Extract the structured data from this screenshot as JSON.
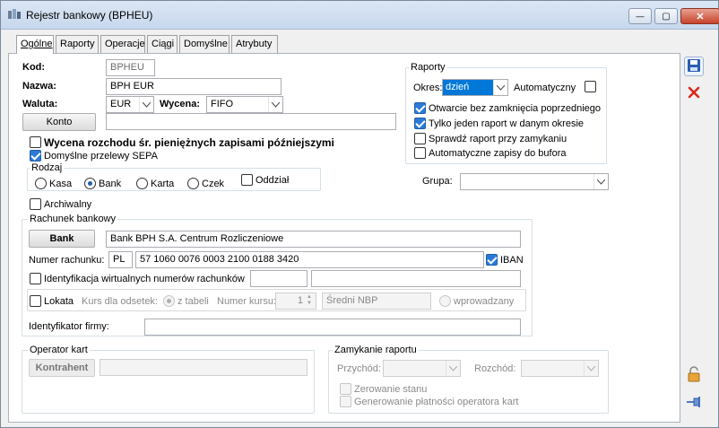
{
  "window": {
    "title": "Rejestr bankowy (BPHEU)",
    "controls": {
      "minimize": "—",
      "maximize": "▢",
      "close": "✕"
    }
  },
  "tabs": [
    "Ogólne",
    "Raporty",
    "Operacje",
    "Ciągi",
    "Domyślne",
    "Atrybuty"
  ],
  "general": {
    "kod_label": "Kod:",
    "kod_value": "BPHEU",
    "nazwa_label": "Nazwa:",
    "nazwa_value": "BPH EUR",
    "waluta_label": "Waluta:",
    "waluta_value": "EUR",
    "wycena_label": "Wycena:",
    "wycena_value": "FIFO",
    "konto_button": "Konto",
    "konto_value": "",
    "wycena_rozchodu_label": "Wycena rozchodu śr. pieniężnych zapisami późniejszymi",
    "domyslne_sepa_label": "Domyślne przelewy SEPA",
    "rodzaj_title": "Rodzaj",
    "rodzaj_options": [
      "Kasa",
      "Bank",
      "Karta",
      "Czek"
    ],
    "rodzaj_selected": "Bank",
    "oddzial_label": "Oddział",
    "archiwalny_label": "Archiwalny"
  },
  "raporty": {
    "title": "Raporty",
    "okres_label": "Okres:",
    "okres_value": "dzień",
    "automatyczny_label": "Automatyczny",
    "options": [
      {
        "label": "Otwarcie bez zamknięcia poprzedniego",
        "checked": true
      },
      {
        "label": "Tylko jeden raport w danym okresie",
        "checked": true
      },
      {
        "label": "Sprawdź raport przy zamykaniu",
        "checked": false
      },
      {
        "label": "Automatyczne zapisy do bufora",
        "checked": false
      }
    ],
    "grupa_label": "Grupa:",
    "grupa_value": ""
  },
  "rachunek": {
    "title": "Rachunek bankowy",
    "bank_button": "Bank",
    "bank_name": "Bank BPH S.A. Centrum Rozliczeniowe",
    "numer_label": "Numer rachunku:",
    "country": "PL",
    "numer_value": "57 1060 0076 0003 2100 0188 3420",
    "iban_label": "IBAN",
    "identyfikacja_label": "Identyfikacja wirtualnych numerów rachunków",
    "lokata_label": "Lokata",
    "kurs_label": "Kurs dla odsetek:",
    "z_tabeli_label": "z tabeli",
    "numer_kursu_label": "Numer kursu:",
    "numer_kursu_value": "1",
    "sredni_nbp": "Średni NBP",
    "wprowadzany_label": "wprowadzany",
    "identyfikator_label": "Identyfikator firmy:",
    "identyfikator_value": ""
  },
  "operator": {
    "title": "Operator kart",
    "kontrahent_button": "Kontrahent",
    "kontrahent_value": ""
  },
  "zamykanie": {
    "title": "Zamykanie raportu",
    "przychod_label": "Przychód:",
    "rozchod_label": "Rozchód:",
    "zerowanie_label": "Zerowanie stanu",
    "generowanie_label": "Generowanie płatności operatora kart"
  },
  "sidebar": {
    "save_icon": "save-icon",
    "cancel_icon": "cancel-icon",
    "lock_icon": "lock-icon",
    "pin_icon": "pin-icon"
  },
  "colors": {
    "accent": "#2b7bd6",
    "cancel": "#d9271c",
    "save": "#2a5db0"
  }
}
